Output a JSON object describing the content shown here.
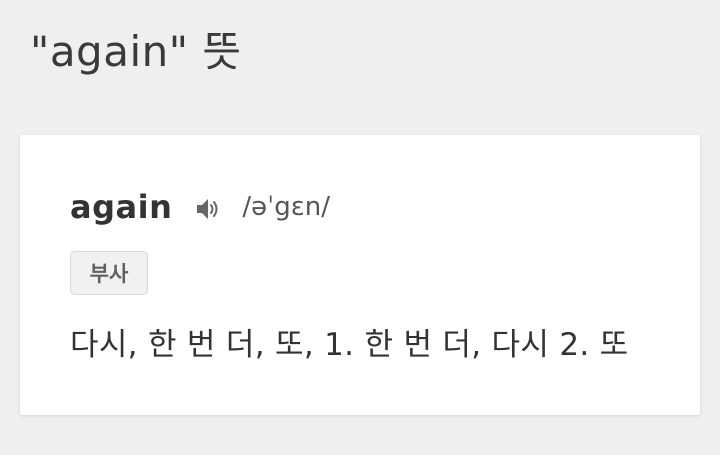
{
  "page": {
    "title": "\"again\" 뜻"
  },
  "entry": {
    "word": "again",
    "speaker_icon": "speaker-icon",
    "pronunciation": "/əˈgɛn/",
    "part_of_speech": "부사",
    "meaning": "다시, 한 번 더, 또, 1. 한 번 더, 다시 2. 또"
  },
  "colors": {
    "background": "#efefef",
    "card": "#ffffff",
    "text": "#333333",
    "badge_bg": "#f1f1f1",
    "badge_border": "#d6d6d6"
  }
}
